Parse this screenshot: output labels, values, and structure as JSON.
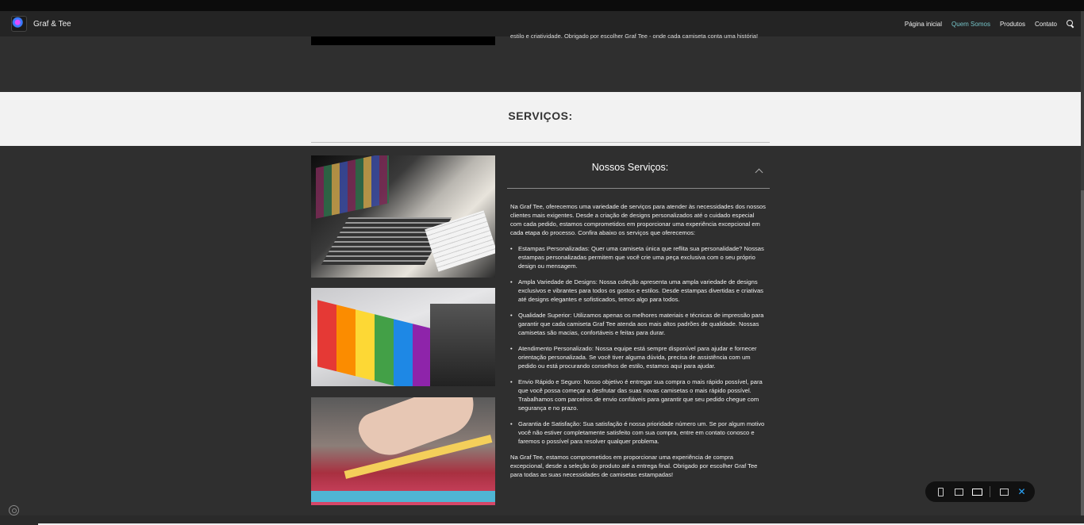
{
  "site": {
    "brand_name": "Graf & Tee"
  },
  "nav": {
    "items": [
      {
        "label": "Página inicial",
        "active": false
      },
      {
        "label": "Quem Somos",
        "active": true
      },
      {
        "label": "Produtos",
        "active": false
      },
      {
        "label": "Contato",
        "active": false
      }
    ],
    "search_icon": "search-icon"
  },
  "about": {
    "tail_text": "estilo e criatividade. Obrigado por escolher Graf Tee - onde cada camiseta conta uma história!"
  },
  "services": {
    "section_title": "SERVIÇOS:",
    "accordion_title": "Nossos Serviços:",
    "intro": "Na Graf Tee, oferecemos uma variedade de serviços para atender às necessidades dos nossos clientes mais exigentes. Desde a criação de designs personalizados até o cuidado especial com cada pedido, estamos comprometidos em proporcionar uma experiência excepcional em cada etapa do processo. Confira abaixo os serviços que oferecemos:",
    "items": [
      "Estampas Personalizadas: Quer uma camiseta única que reflita sua personalidade? Nossas estampas personalizadas permitem que você crie uma peça exclusiva com o seu próprio design ou mensagem.",
      "Ampla Variedade de Designs: Nossa coleção apresenta uma ampla variedade de designs exclusivos e vibrantes para todos os gostos e estilos. Desde estampas divertidas e criativas até designs elegantes e sofisticados, temos algo para todos.",
      "Qualidade Superior: Utilizamos apenas os melhores materiais e técnicas de impressão para garantir que cada camiseta Graf Tee atenda aos mais altos padrões de qualidade. Nossas camisetas são macias, confortáveis e feitas para durar.",
      "Atendimento Personalizado: Nossa equipe está sempre disponível para ajudar e fornecer orientação personalizada. Se você tiver alguma dúvida, precisa de assistência com um pedido ou está procurando conselhos de estilo, estamos aqui para ajudar.",
      "Envio Rápido e Seguro: Nosso objetivo é entregar sua compra o mais rápido possível, para que você possa começar a desfrutar das suas novas camisetas o mais rápido possível. Trabalhamos com parceiros de envio confiáveis para garantir que seu pedido chegue com segurança e no prazo.",
      "Garantia de Satisfação: Sua satisfação é nossa prioridade número um. Se por algum motivo você não estiver completamente satisfeito com sua compra, entre em contato conosco e faremos o possível para resolver qualquer problema."
    ],
    "closing": "Na Graf Tee, estamos comprometidos em proporcionar uma experiência de compra excepcional, desde a seleção do produto até a entrega final. Obrigado por escolher Graf Tee para todas as suas necessidades de camisetas estampadas!"
  },
  "colors": {
    "background": "#2f2f2f",
    "navbar": "#242424",
    "nav_active": "#76c5c9",
    "band": "#f2f2f2",
    "toolbar_close": "#2aa7ff"
  },
  "toolbar": {
    "icons": [
      "mobile-view-icon",
      "tablet-view-icon",
      "desktop-view-icon",
      "comment-icon",
      "close-icon"
    ]
  }
}
